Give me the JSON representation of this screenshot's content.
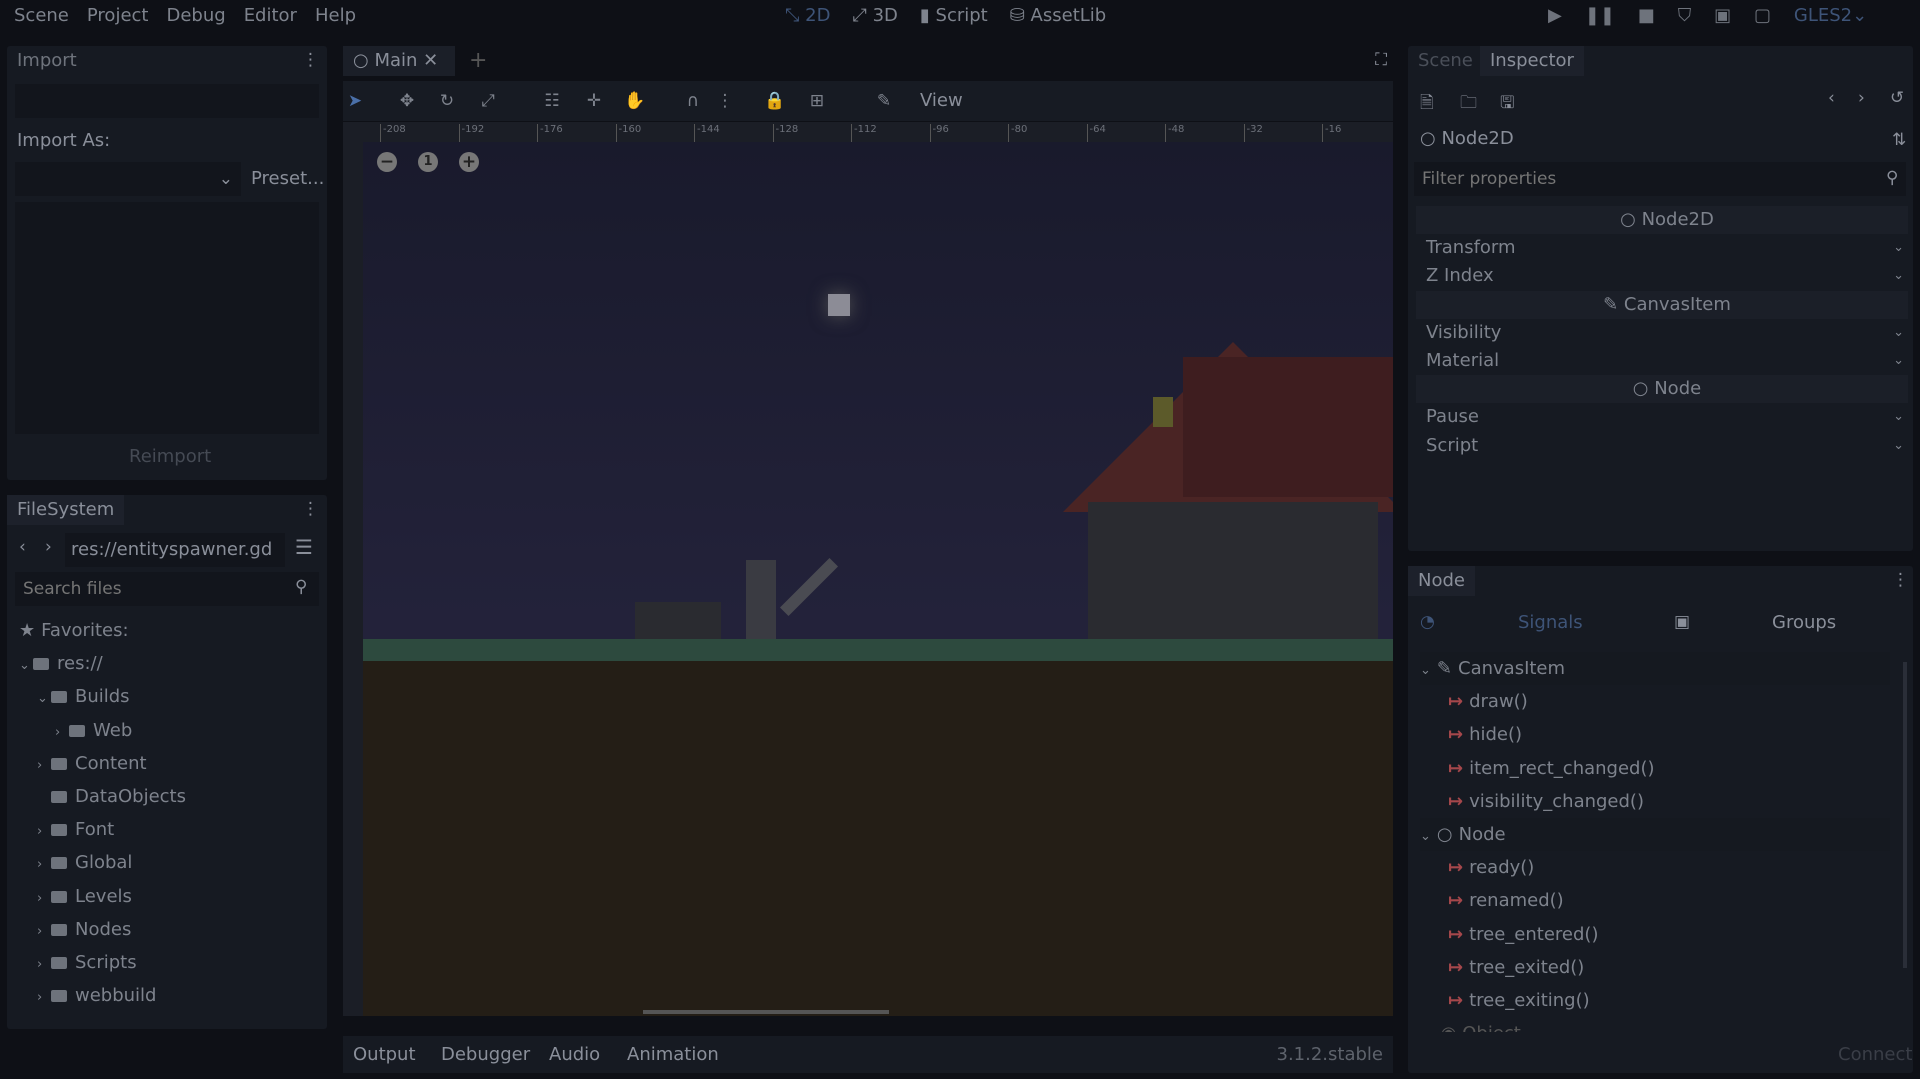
{
  "menu": [
    "Scene",
    "Project",
    "Debug",
    "Editor",
    "Help"
  ],
  "workspaces": [
    {
      "label": "2D",
      "icon": "2d-icon",
      "active": true
    },
    {
      "label": "3D",
      "icon": "3d-icon"
    },
    {
      "label": "Script",
      "icon": "script-icon"
    },
    {
      "label": "AssetLib",
      "icon": "assetlib-icon"
    }
  ],
  "renderer": "GLES2",
  "import": {
    "tab": "Import",
    "import_as": "Import As:",
    "preset": "Preset...",
    "reimport": "Reimport"
  },
  "filesystem": {
    "tab": "FileSystem",
    "path": "res://entityspawner.gd",
    "search_placeholder": "Search files",
    "items": [
      {
        "label": "Favorites:",
        "depth": 0,
        "icon": "star-icon"
      },
      {
        "label": "res://",
        "depth": 0
      },
      {
        "label": "Builds",
        "depth": 1
      },
      {
        "label": "Web",
        "depth": 2
      },
      {
        "label": "Content",
        "depth": 1
      },
      {
        "label": "DataObjects",
        "depth": 1
      },
      {
        "label": "Font",
        "depth": 1
      },
      {
        "label": "Global",
        "depth": 1
      },
      {
        "label": "Levels",
        "depth": 1
      },
      {
        "label": "Nodes",
        "depth": 1
      },
      {
        "label": "Scripts",
        "depth": 1
      },
      {
        "label": "webbuild",
        "depth": 1
      }
    ]
  },
  "editor": {
    "tab": "Main",
    "view": "View",
    "ruler": [
      "-208",
      "-192",
      "-176",
      "-160",
      "-144",
      "-128",
      "-112",
      "-96",
      "-80",
      "-64",
      "-48",
      "-32",
      "-16"
    ]
  },
  "bottom": {
    "tabs": [
      "Output",
      "Debugger",
      "Audio",
      "Animation"
    ],
    "version": "3.1.2.stable"
  },
  "inspector": {
    "tabs": [
      "Scene",
      "Inspector"
    ],
    "node": "Node2D",
    "filter_placeholder": "Filter properties",
    "rows": [
      {
        "label": "Node2D",
        "section": true
      },
      {
        "label": "Transform"
      },
      {
        "label": "Z Index"
      },
      {
        "label": "CanvasItem",
        "section": true
      },
      {
        "label": "Visibility"
      },
      {
        "label": "Material"
      },
      {
        "label": "Node",
        "section": true
      },
      {
        "label": "Pause"
      },
      {
        "label": "Script"
      }
    ]
  },
  "node_dock": {
    "tab": "Node",
    "signals": "Signals",
    "groups": "Groups",
    "connect": "Connect",
    "groups_list": [
      {
        "label": "CanvasItem",
        "signals": [
          "draw()",
          "hide()",
          "item_rect_changed()",
          "visibility_changed()"
        ]
      },
      {
        "label": "Node",
        "signals": [
          "ready()",
          "renamed()",
          "tree_entered()",
          "tree_exited()",
          "tree_exiting()"
        ]
      }
    ],
    "partial": "Object"
  },
  "colors": {
    "accent": "#4a6fa8",
    "signal": "#a5474b"
  }
}
